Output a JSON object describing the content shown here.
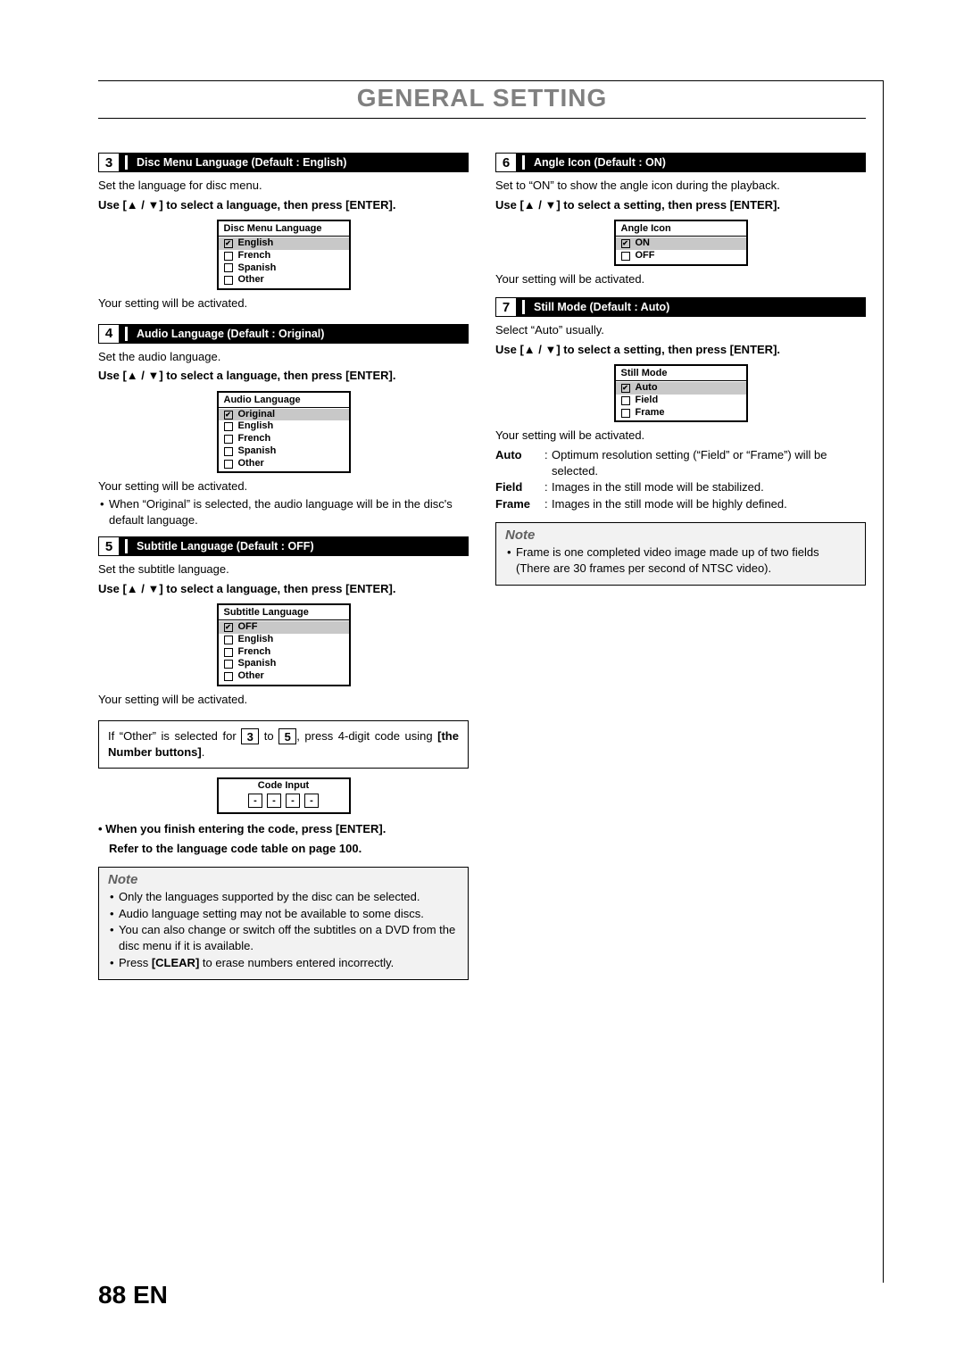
{
  "page": {
    "title": "GENERAL SETTING",
    "number": "88",
    "lang": "EN"
  },
  "sections": {
    "s3": {
      "num": "3",
      "title": "Disc Menu Language (Default : English)",
      "intro": "Set the language for disc menu.",
      "instruction": "Use [▲ / ▼] to select a language, then press [ENTER].",
      "menu_title": "Disc Menu Language",
      "options": [
        "English",
        "French",
        "Spanish",
        "Other"
      ],
      "activated": "Your setting will be activated."
    },
    "s4": {
      "num": "4",
      "title": "Audio Language (Default : Original)",
      "intro": "Set the audio language.",
      "instruction": "Use [▲ / ▼] to select a language, then press [ENTER].",
      "menu_title": "Audio Language",
      "options": [
        "Original",
        "English",
        "French",
        "Spanish",
        "Other"
      ],
      "activated": "Your setting will be activated.",
      "bullet1": "When “Original” is selected, the audio language will be in the disc's default language."
    },
    "s5": {
      "num": "5",
      "title": "Subtitle Language (Default : OFF)",
      "intro": "Set the subtitle language.",
      "instruction": "Use [▲ / ▼] to select a language, then press [ENTER].",
      "menu_title": "Subtitle Language",
      "options": [
        "OFF",
        "English",
        "French",
        "Spanish",
        "Other"
      ],
      "activated": "Your setting will be activated."
    },
    "other_box": {
      "pre": "If “Other” is selected for ",
      "mid": " to ",
      "post": ", press 4-digit code using ",
      "bold_end": "[the Number buttons]",
      "period": ".",
      "num_a": "3",
      "num_b": "5"
    },
    "code_input": {
      "title": "Code Input",
      "digit": "-"
    },
    "enter_line1": "• When you finish entering the code, press [ENTER].",
    "enter_line2": "Refer to the language code table on page 100.",
    "note_left": {
      "label": "Note",
      "items": [
        "Only the languages supported by the disc can be selected.",
        "Audio language setting may not be available to some discs.",
        "You can also change or switch off the subtitles on a DVD from the disc menu if it is available."
      ],
      "clear_pre": "Press ",
      "clear_bold": "[CLEAR]",
      "clear_post": " to erase numbers entered incorrectly."
    },
    "s6": {
      "num": "6",
      "title": "Angle Icon (Default : ON)",
      "intro": "Set to “ON” to show the angle icon during the playback.",
      "instruction": "Use [▲ / ▼] to select a setting, then press [ENTER].",
      "menu_title": "Angle Icon",
      "options": [
        "ON",
        "OFF"
      ],
      "activated": "Your setting will be activated."
    },
    "s7": {
      "num": "7",
      "title": "Still Mode (Default : Auto)",
      "intro": "Select “Auto” usually.",
      "instruction": "Use [▲ / ▼] to select a setting, then press [ENTER].",
      "menu_title": "Still Mode",
      "options": [
        "Auto",
        "Field",
        "Frame"
      ],
      "activated": "Your setting will be activated.",
      "defs": [
        {
          "term": "Auto",
          "desc": "Optimum resolution setting (“Field” or “Frame”) will be selected."
        },
        {
          "term": "Field",
          "desc": "Images in the still mode will be stabilized."
        },
        {
          "term": "Frame",
          "desc": "Images in the still mode will be highly defined."
        }
      ]
    },
    "note_right": {
      "label": "Note",
      "items": [
        "Frame is one completed video image made up of two fields (There are 30 frames per second of NTSC video)."
      ]
    }
  }
}
